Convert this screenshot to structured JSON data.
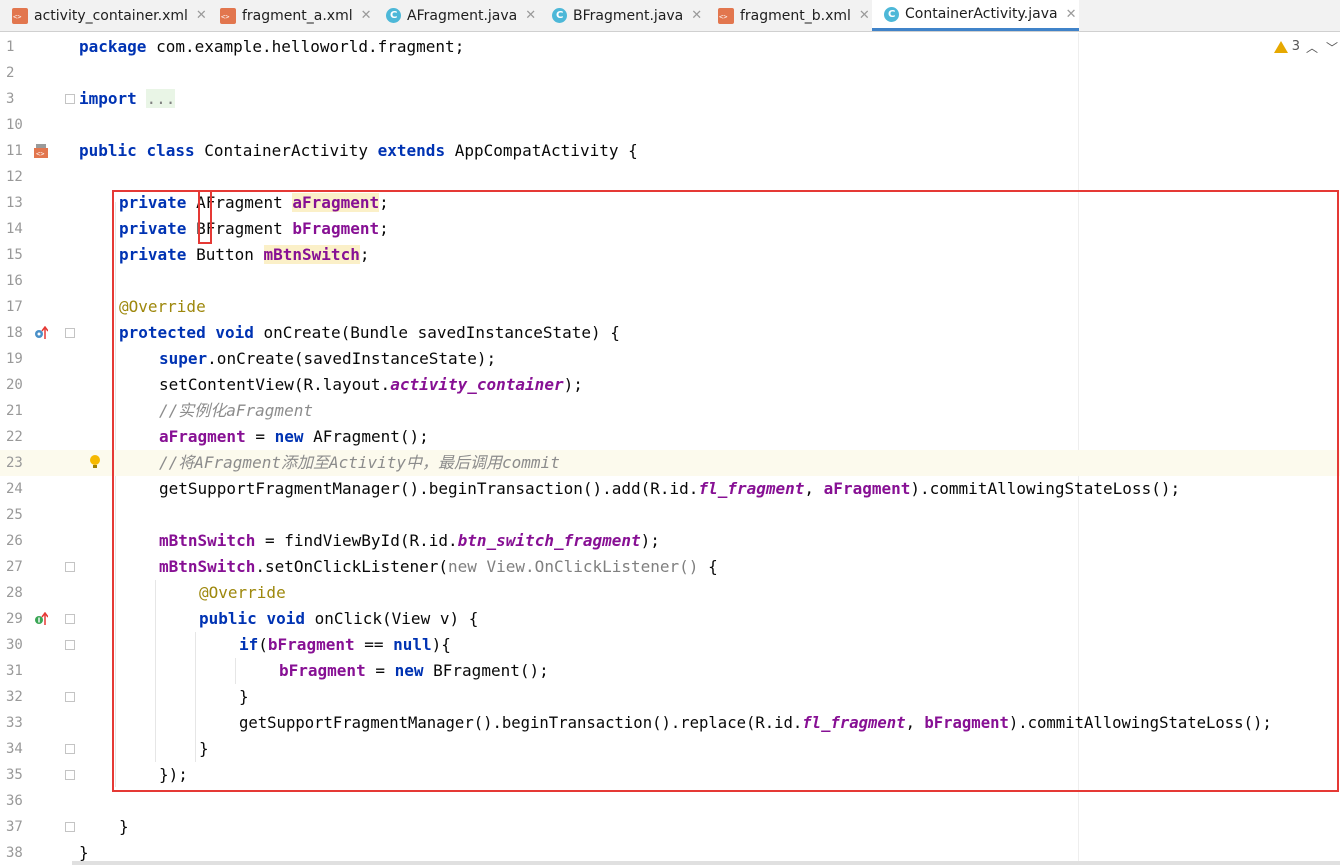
{
  "tabs": [
    {
      "label": "activity_container.xml",
      "type": "xml",
      "active": false
    },
    {
      "label": "fragment_a.xml",
      "type": "xml",
      "active": false
    },
    {
      "label": "AFragment.java",
      "type": "java",
      "active": false
    },
    {
      "label": "BFragment.java",
      "type": "java",
      "active": false
    },
    {
      "label": "fragment_b.xml",
      "type": "xml",
      "active": false
    },
    {
      "label": "ContainerActivity.java",
      "type": "java",
      "active": true
    }
  ],
  "warnings": {
    "count": "3",
    "icon": "warning-icon"
  },
  "line_numbers": [
    "1",
    "2",
    "3",
    "10",
    "11",
    "12",
    "13",
    "14",
    "15",
    "16",
    "17",
    "18",
    "19",
    "20",
    "21",
    "22",
    "23",
    "24",
    "25",
    "26",
    "27",
    "28",
    "29",
    "30",
    "31",
    "32",
    "33",
    "34",
    "35",
    "36",
    "37",
    "38"
  ],
  "code": {
    "l1": {
      "kw": "package",
      "rest": " com.example.helloworld.fragment;"
    },
    "l3": {
      "kw": "import",
      "fold": "..."
    },
    "l11": {
      "kw1": "public",
      "kw2": "class",
      "name": " ContainerActivity ",
      "kw3": "extends",
      "rest": " AppCompatActivity {"
    },
    "l13": {
      "kw": "private",
      "type": " AFragment ",
      "field": "aFragment",
      "end": ";"
    },
    "l14": {
      "kw": "private",
      "type": " BFragment ",
      "field": "bFragment",
      "end": ";"
    },
    "l15": {
      "kw": "private",
      "type": " Button ",
      "field": "mBtnSwitch",
      "end": ";"
    },
    "l17": {
      "ann": "@Override"
    },
    "l18": {
      "kw1": "protected",
      "kw2": "void",
      "rest": " onCreate(Bundle savedInstanceState) {"
    },
    "l19": {
      "kw": "super",
      "rest": ".onCreate(savedInstanceState);"
    },
    "l20": {
      "pre": "setContentView(R.layout.",
      "field": "activity_container",
      "end": ");"
    },
    "l21": {
      "comment": "//实例化aFragment"
    },
    "l22": {
      "field": "aFragment",
      "mid": " = ",
      "kw": "new",
      "rest": " AFragment();"
    },
    "l23": {
      "comment": "//将AFragment添加至Activity中，最后调用commit"
    },
    "l24": {
      "pre": "getSupportFragmentManager().beginTransaction().add(R.id.",
      "sfield": "fl_fragment",
      "mid": ", ",
      "field": "aFragment",
      "end": ").commitAllowingStateLoss();"
    },
    "l26": {
      "field": "mBtnSwitch",
      "mid": " = findViewById(R.id.",
      "sfield": "btn_switch_fragment",
      "end": ");"
    },
    "l27": {
      "field": "mBtnSwitch",
      "mid": ".setOnClickListener(",
      "grey": "new View.OnClickListener()",
      "end": " {"
    },
    "l28": {
      "ann": "@Override"
    },
    "l29": {
      "kw1": "public",
      "kw2": "void",
      "rest": " onClick(View v) {"
    },
    "l30": {
      "kw": "if",
      "pre": "(",
      "field": "bFragment",
      "mid": " == ",
      "kw2": "null",
      "end": "){"
    },
    "l31": {
      "field": "bFragment",
      "mid": " = ",
      "kw": "new",
      "rest": " BFragment();"
    },
    "l32": {
      "text": "}"
    },
    "l33": {
      "pre": "getSupportFragmentManager().beginTransaction().replace(R.id.",
      "sfield": "fl_fragment",
      "mid": ", ",
      "field": "bFragment",
      "end": ").commitAllowingStateLoss();"
    },
    "l34": {
      "text": "}"
    },
    "l35": {
      "text": "});"
    },
    "l37": {
      "text": "}"
    },
    "l38": {
      "text": "}"
    }
  }
}
